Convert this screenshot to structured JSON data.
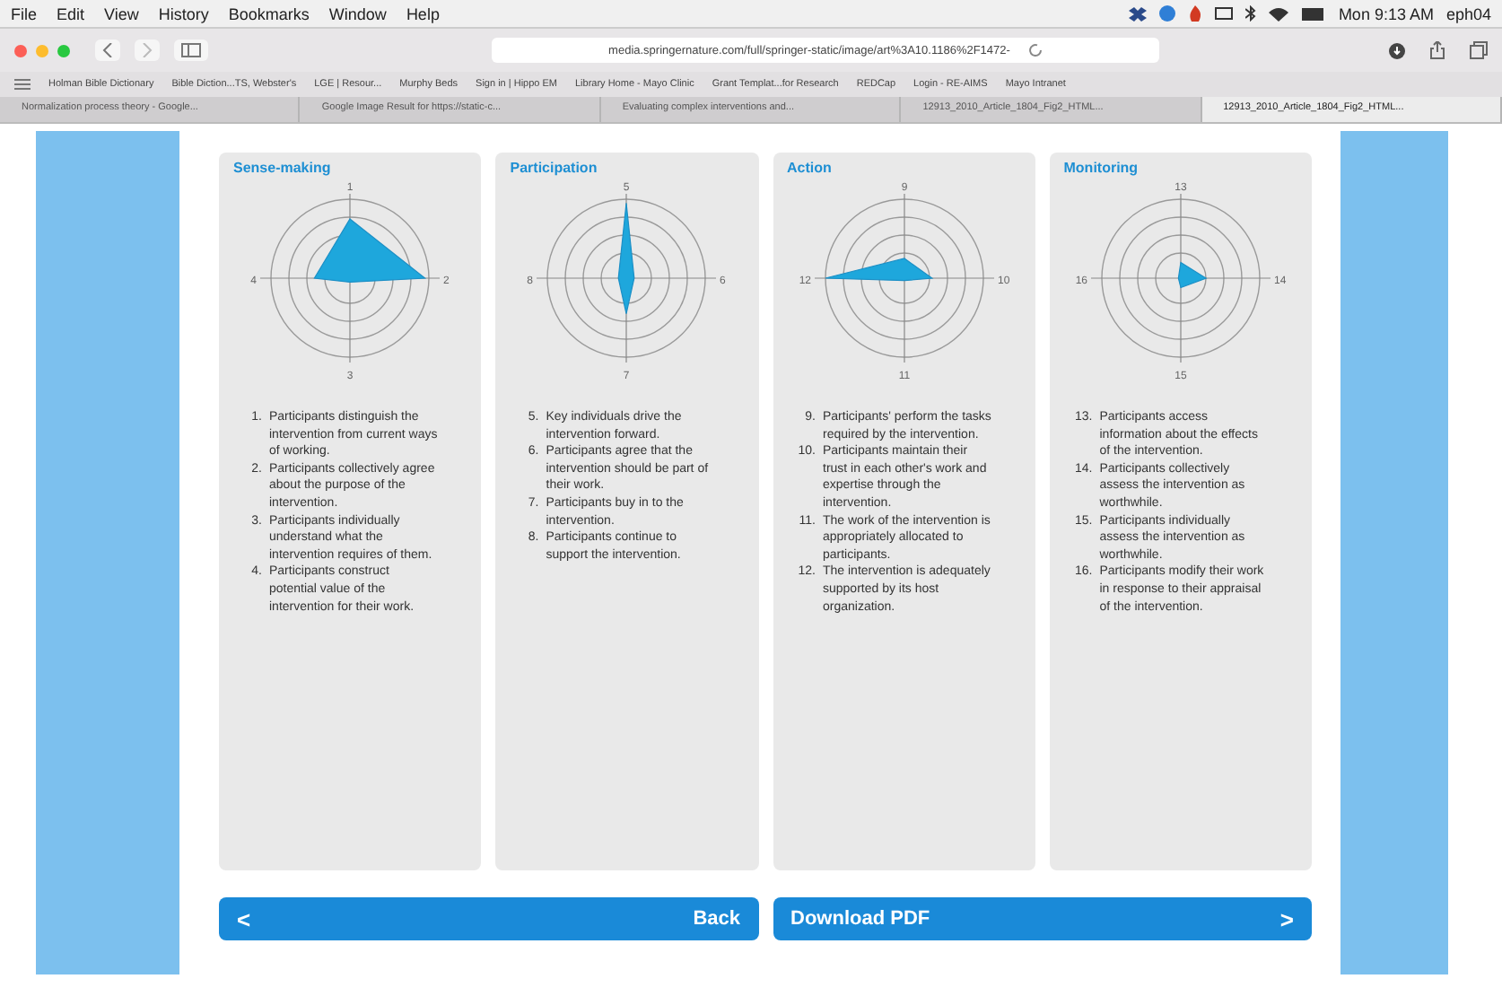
{
  "menu_bar": {
    "items": [
      "File",
      "Edit",
      "View",
      "History",
      "Bookmarks",
      "Window",
      "Help"
    ],
    "clock": "Mon 9:13 AM",
    "user": "eph04"
  },
  "toolbar": {
    "url": "media.springernature.com/full/springer-static/image/art%3A10.1186%2F1472-"
  },
  "bookmarks": [
    "Holman Bible Dictionary",
    "Bible Diction...TS, Webster's",
    "LGE | Resour...",
    "Murphy Beds",
    "Sign in | Hippo EM",
    "Library Home - Mayo Clinic",
    "Grant Templat...for Research",
    "REDCap",
    "Login - RE-AIMS",
    "Mayo Intranet"
  ],
  "tabs": [
    {
      "label": "Normalization process theory - Google...",
      "selected": false
    },
    {
      "label": "Google Image Result for https://static-c...",
      "selected": false
    },
    {
      "label": "Evaluating complex interventions and...",
      "selected": false
    },
    {
      "label": "12913_2010_Article_1804_Fig2_HTML...",
      "selected": false
    },
    {
      "label": "12913_2010_Article_1804_Fig2_HTML...",
      "selected": true
    }
  ],
  "panels": [
    {
      "title": "Sense-making",
      "axes": [
        "1",
        "2",
        "3",
        "4"
      ],
      "items": [
        {
          "number": "1.",
          "text": "Participants distinguish the intervention from current ways of working."
        },
        {
          "number": "2.",
          "text": "Participants collectively agree about the purpose of the intervention."
        },
        {
          "number": "3.",
          "text": "Participants individually understand what the intervention requires of them."
        },
        {
          "number": "4.",
          "text": "Participants construct potential value of the intervention for their work."
        }
      ]
    },
    {
      "title": "Participation",
      "axes": [
        "5",
        "6",
        "7",
        "8"
      ],
      "items": [
        {
          "number": "5.",
          "text": "Key individuals drive the intervention forward."
        },
        {
          "number": "6.",
          "text": "Participants agree that the intervention should be part of their work."
        },
        {
          "number": "7.",
          "text": "Participants buy in to the intervention."
        },
        {
          "number": "8.",
          "text": "Participants continue to support the intervention."
        }
      ]
    },
    {
      "title": "Action",
      "axes": [
        "9",
        "10",
        "11",
        "12"
      ],
      "items": [
        {
          "number": "9.",
          "text": "Participants' perform the tasks required by the intervention."
        },
        {
          "number": "10.",
          "text": "Participants maintain their trust in each other's work and expertise through the intervention."
        },
        {
          "number": "11.",
          "text": "The work of the intervention is appropriately allocated to participants."
        },
        {
          "number": "12.",
          "text": "The intervention is adequately supported by its host organization."
        }
      ]
    },
    {
      "title": "Monitoring",
      "axes": [
        "13",
        "14",
        "15",
        "16"
      ],
      "items": [
        {
          "number": "13.",
          "text": "Participants access information about the effects of the intervention."
        },
        {
          "number": "14.",
          "text": "Participants collectively assess the intervention as worthwhile."
        },
        {
          "number": "15.",
          "text": "Participants individually assess the intervention as worthwhile."
        },
        {
          "number": "16.",
          "text": "Participants modify their work in response to their appraisal of the intervention."
        }
      ]
    }
  ],
  "nav": {
    "back_arrow": "<",
    "back": "Back",
    "download": "Download PDF",
    "next_arrow": ">"
  }
}
